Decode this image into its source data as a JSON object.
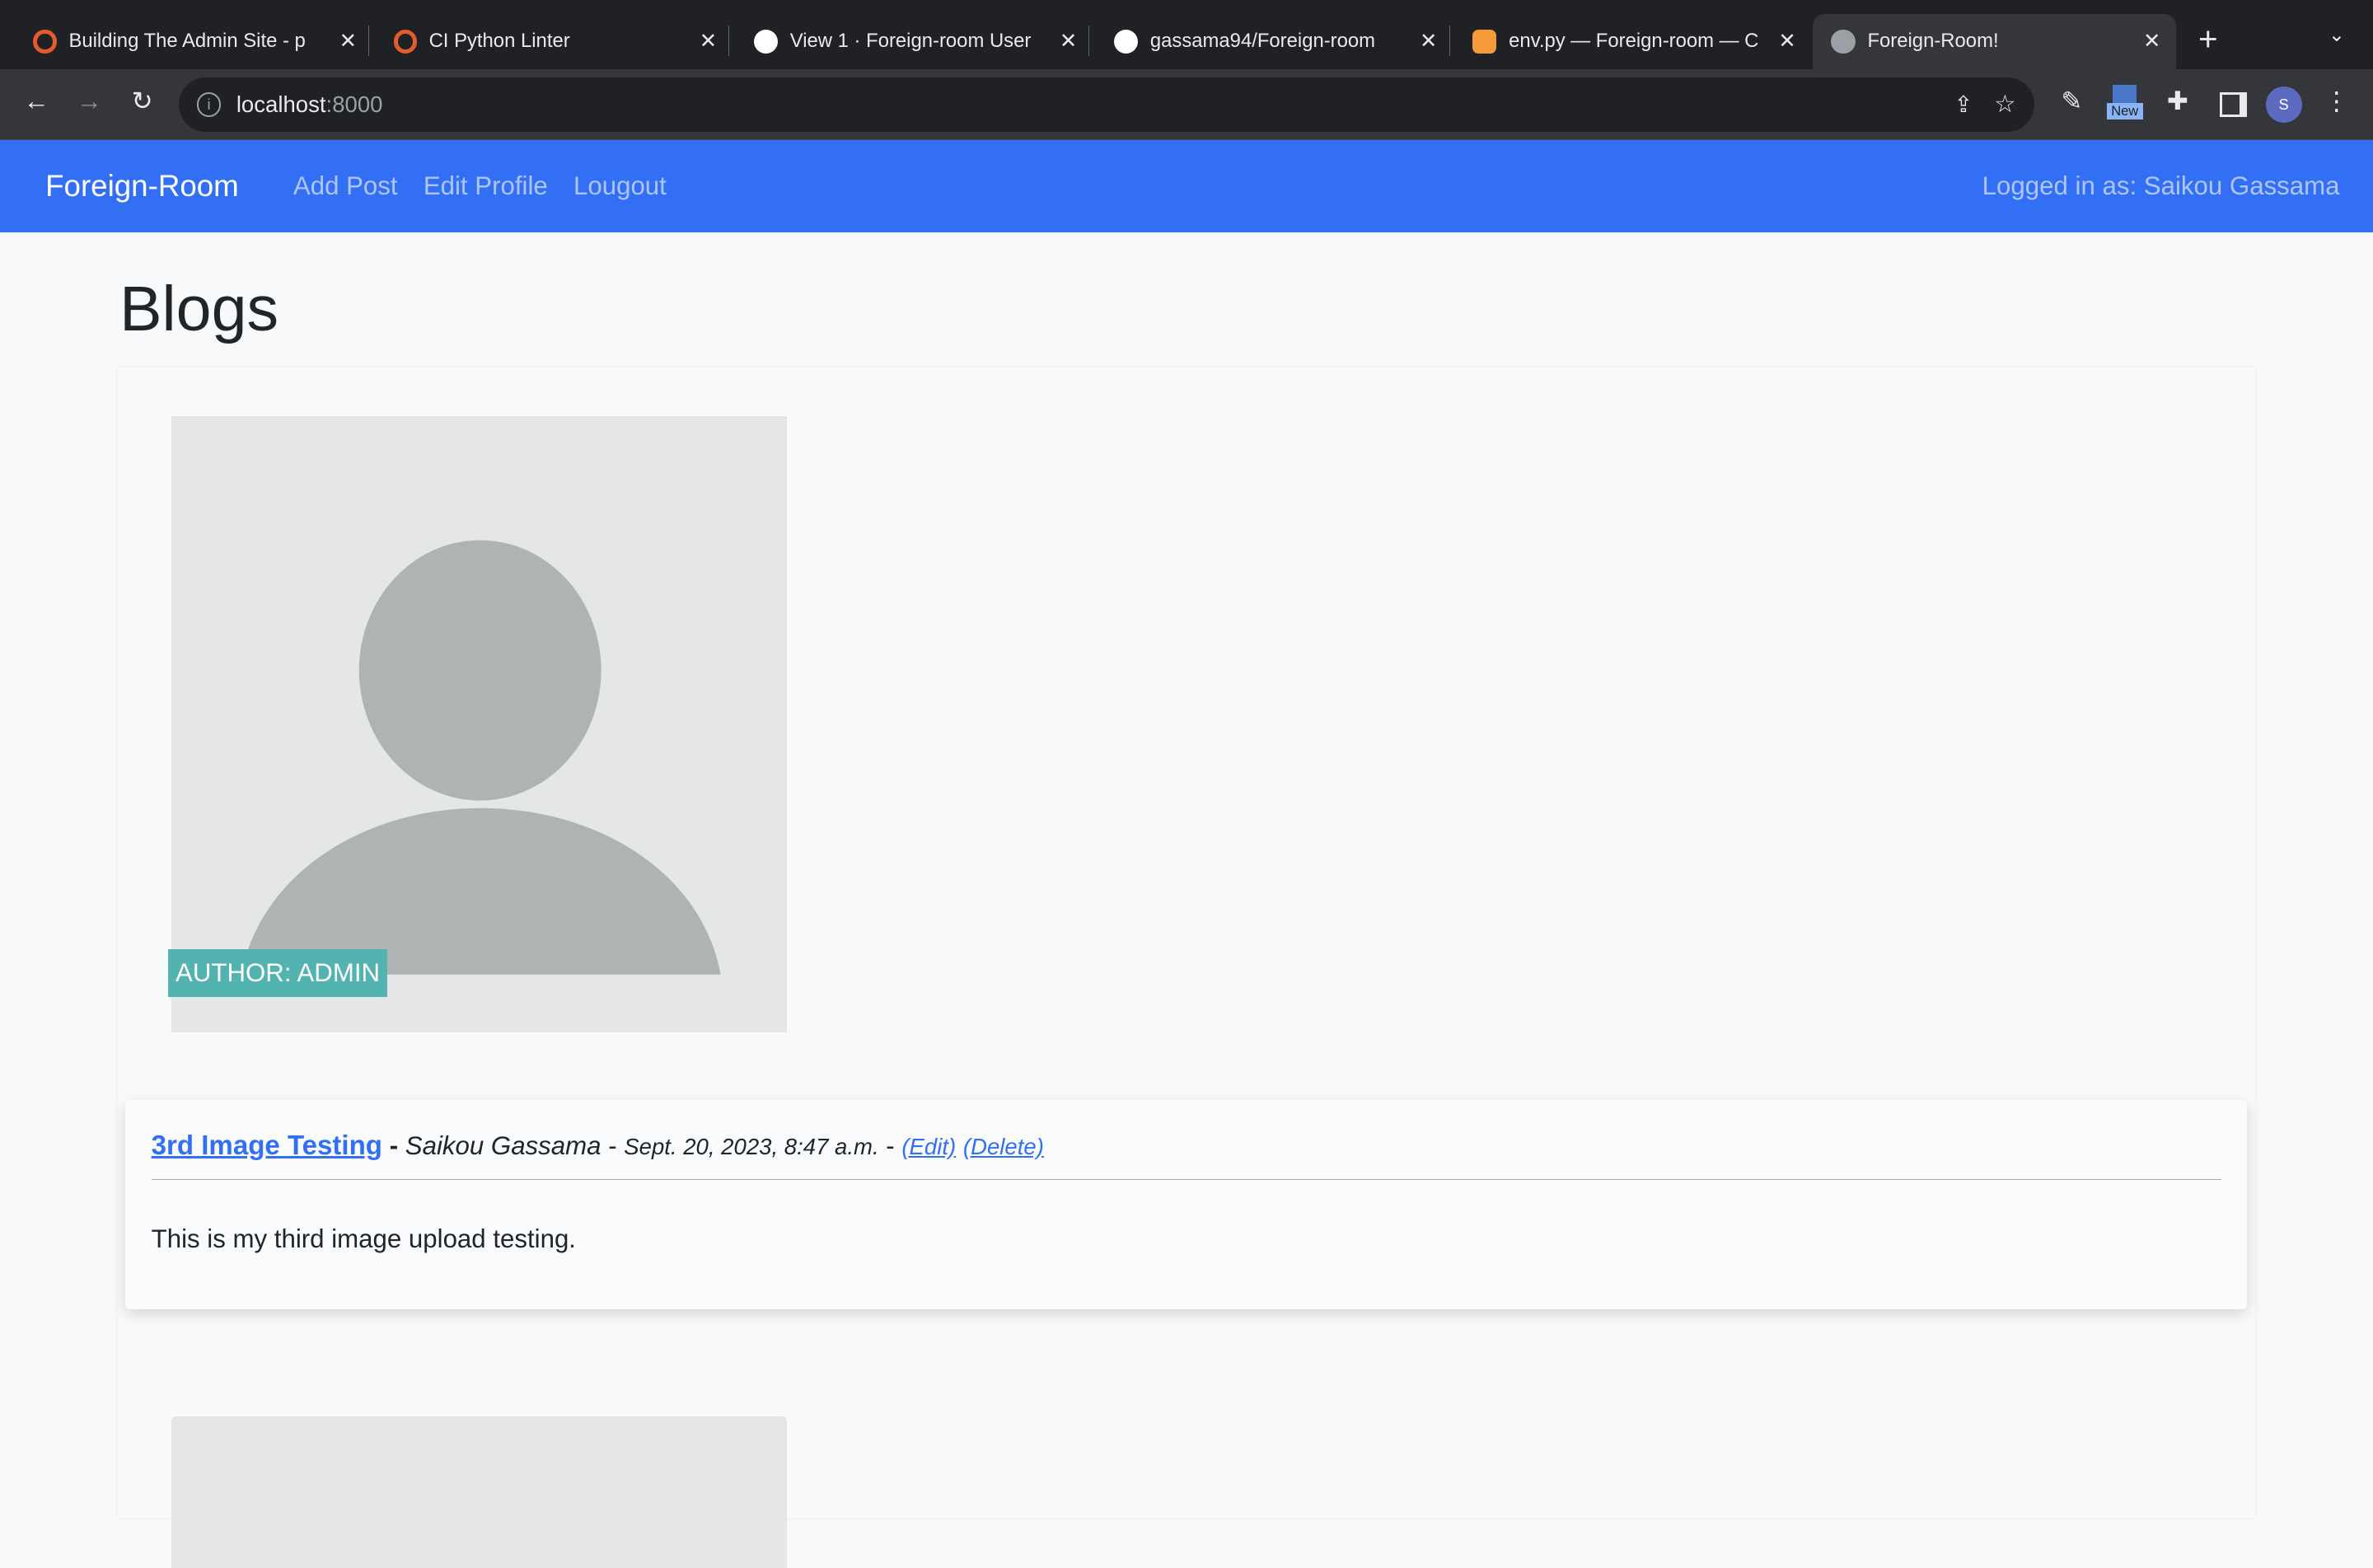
{
  "browser": {
    "tabs": [
      {
        "title": "Building The Admin Site - p",
        "icon": "circle-icon",
        "color": "#e25c2c"
      },
      {
        "title": "CI Python Linter",
        "icon": "circle-icon",
        "color": "#e25c2c"
      },
      {
        "title": "View 1 · Foreign-room User",
        "icon": "github-icon",
        "color": "#ffffff"
      },
      {
        "title": "gassama94/Foreign-room",
        "icon": "github-icon",
        "color": "#ffffff"
      },
      {
        "title": "env.py — Foreign-room — C",
        "icon": "gitpod-icon",
        "color": "#f59a3a"
      },
      {
        "title": "Foreign-Room!",
        "icon": "globe-icon",
        "color": "#9aa0a6"
      }
    ],
    "url_host": "localhost",
    "url_port": ":8000",
    "profile_initial": "S",
    "extension_badge": "New"
  },
  "nav": {
    "brand": "Foreign-Room",
    "links": [
      "Add Post",
      "Edit Profile",
      "Lougout"
    ],
    "user": "Logged in as: Saikou Gassama",
    "color": "#326ff5"
  },
  "page": {
    "title": "Blogs"
  },
  "posts": [
    {
      "author_badge": "AUTHOR: ADMIN",
      "title": "3rd Image Testing",
      "author": "Saikou Gassama",
      "date": "Sept. 20, 2023, 8:47 a.m.",
      "edit": "(Edit)",
      "delete": "(Delete)",
      "excerpt": "This is my third image upload testing."
    }
  ]
}
